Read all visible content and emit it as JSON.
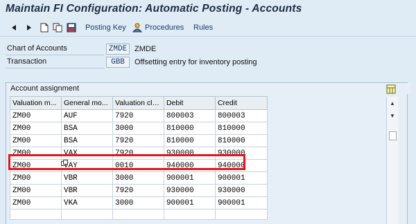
{
  "window": {
    "title": "Maintain FI Configuration: Automatic Posting - Accounts"
  },
  "toolbar": {
    "posting_key": "Posting Key",
    "procedures": "Procedures",
    "rules": "Rules"
  },
  "header_fields": {
    "chart_of_accounts": {
      "label": "Chart of Accounts",
      "code": "ZMDE",
      "description": "ZMDE"
    },
    "transaction": {
      "label": "Transaction",
      "code": "GBB",
      "description": "Offsetting entry for inventory posting"
    }
  },
  "account_assignment": {
    "title": "Account assignment",
    "columns": [
      "Valuation m...",
      "General mo...",
      "Valuation class",
      "Debit",
      "Credit"
    ],
    "rows": [
      [
        "ZM00",
        "AUF",
        "7920",
        "800003",
        "800003"
      ],
      [
        "ZM00",
        "BSA",
        "3000",
        "810000",
        "810000"
      ],
      [
        "ZM00",
        "BSA",
        "7920",
        "810000",
        "810000"
      ],
      [
        "ZM00",
        "VAX",
        "7920",
        "930000",
        "930000"
      ],
      [
        "ZM00",
        "VAY",
        "0010",
        "940000",
        "940000"
      ],
      [
        "ZM00",
        "VBR",
        "3000",
        "900001",
        "900001"
      ],
      [
        "ZM00",
        "VBR",
        "7920",
        "930000",
        "930000"
      ],
      [
        "ZM00",
        "VKA",
        "3000",
        "900001",
        "900001"
      ]
    ],
    "highlighted_row_index": 4
  },
  "colors": {
    "highlight": "#e3141b",
    "background": "#dfebf5"
  }
}
